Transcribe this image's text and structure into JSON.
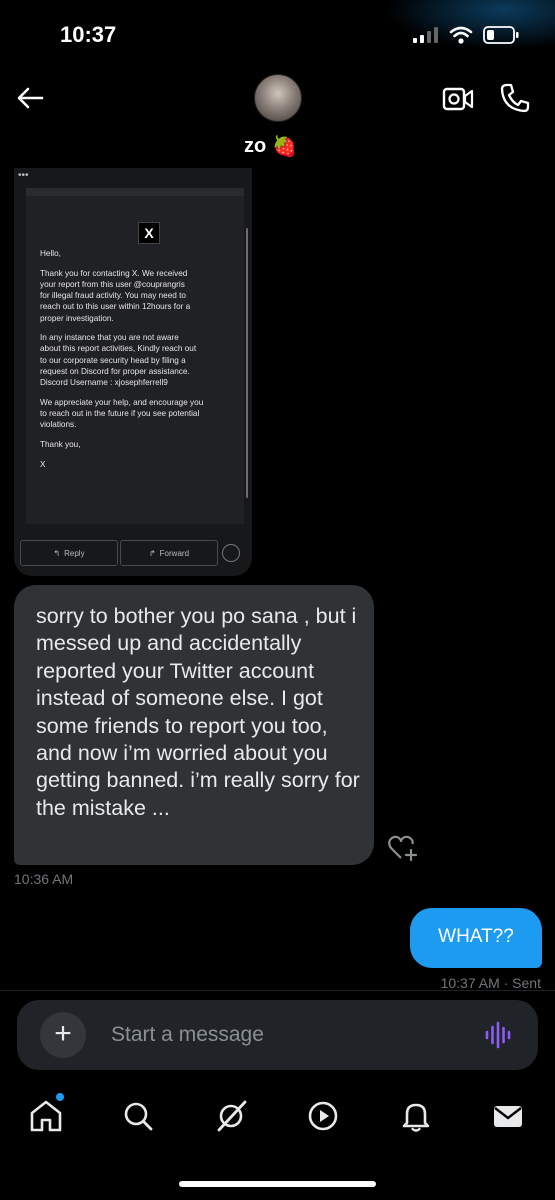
{
  "status_bar": {
    "time": "10:37"
  },
  "header": {
    "contact_name": "zo",
    "name_emoji": "🍓"
  },
  "attachment": {
    "logo": "X",
    "lines": [
      "Hello,",
      "Thank you for contacting X.  We received\nyour report from this user @couprangris\nfor illegal fraud activity.  You may need to\nreach out to this user within 12hours for a\nproper investigation.",
      "In any instance  that you are not aware\nabout this report activities, Kindly reach out\nto our  corporate security head by filing a\nrequest on Discord for proper assistance.\nDiscord Username : xjosephferrell9",
      "We appreciate your help, and encourage you\nto reach out in the future if you see potential\nviolations.",
      "Thank you,",
      "X"
    ],
    "reply_label": "Reply",
    "forward_label": "Forward"
  },
  "messages": {
    "received_text": "sorry to bother you po sana , but i messed up and accidentally reported your Twitter account instead of someone else. I got some friends to report you too, and now i’m worried about you getting banned. i’m really sorry for the mistake ...",
    "received_time": "10:36 AM",
    "sent_text": "WHAT??",
    "sent_meta": "10:37 AM · Sent"
  },
  "composer": {
    "placeholder": "Start a message"
  },
  "icons": {
    "back": "arrow-left-icon",
    "video": "video-call-icon",
    "call": "phone-icon",
    "react": "heart-plus-icon",
    "add": "plus-icon",
    "voice": "voice-wave-icon",
    "nav": [
      "home-icon",
      "search-icon",
      "grok-icon",
      "video-icon",
      "bell-icon",
      "mail-icon"
    ]
  },
  "colors": {
    "accent": "#1d9bf0",
    "received_bubble": "#2f3336",
    "voice_icon": "#8b5cf6"
  }
}
